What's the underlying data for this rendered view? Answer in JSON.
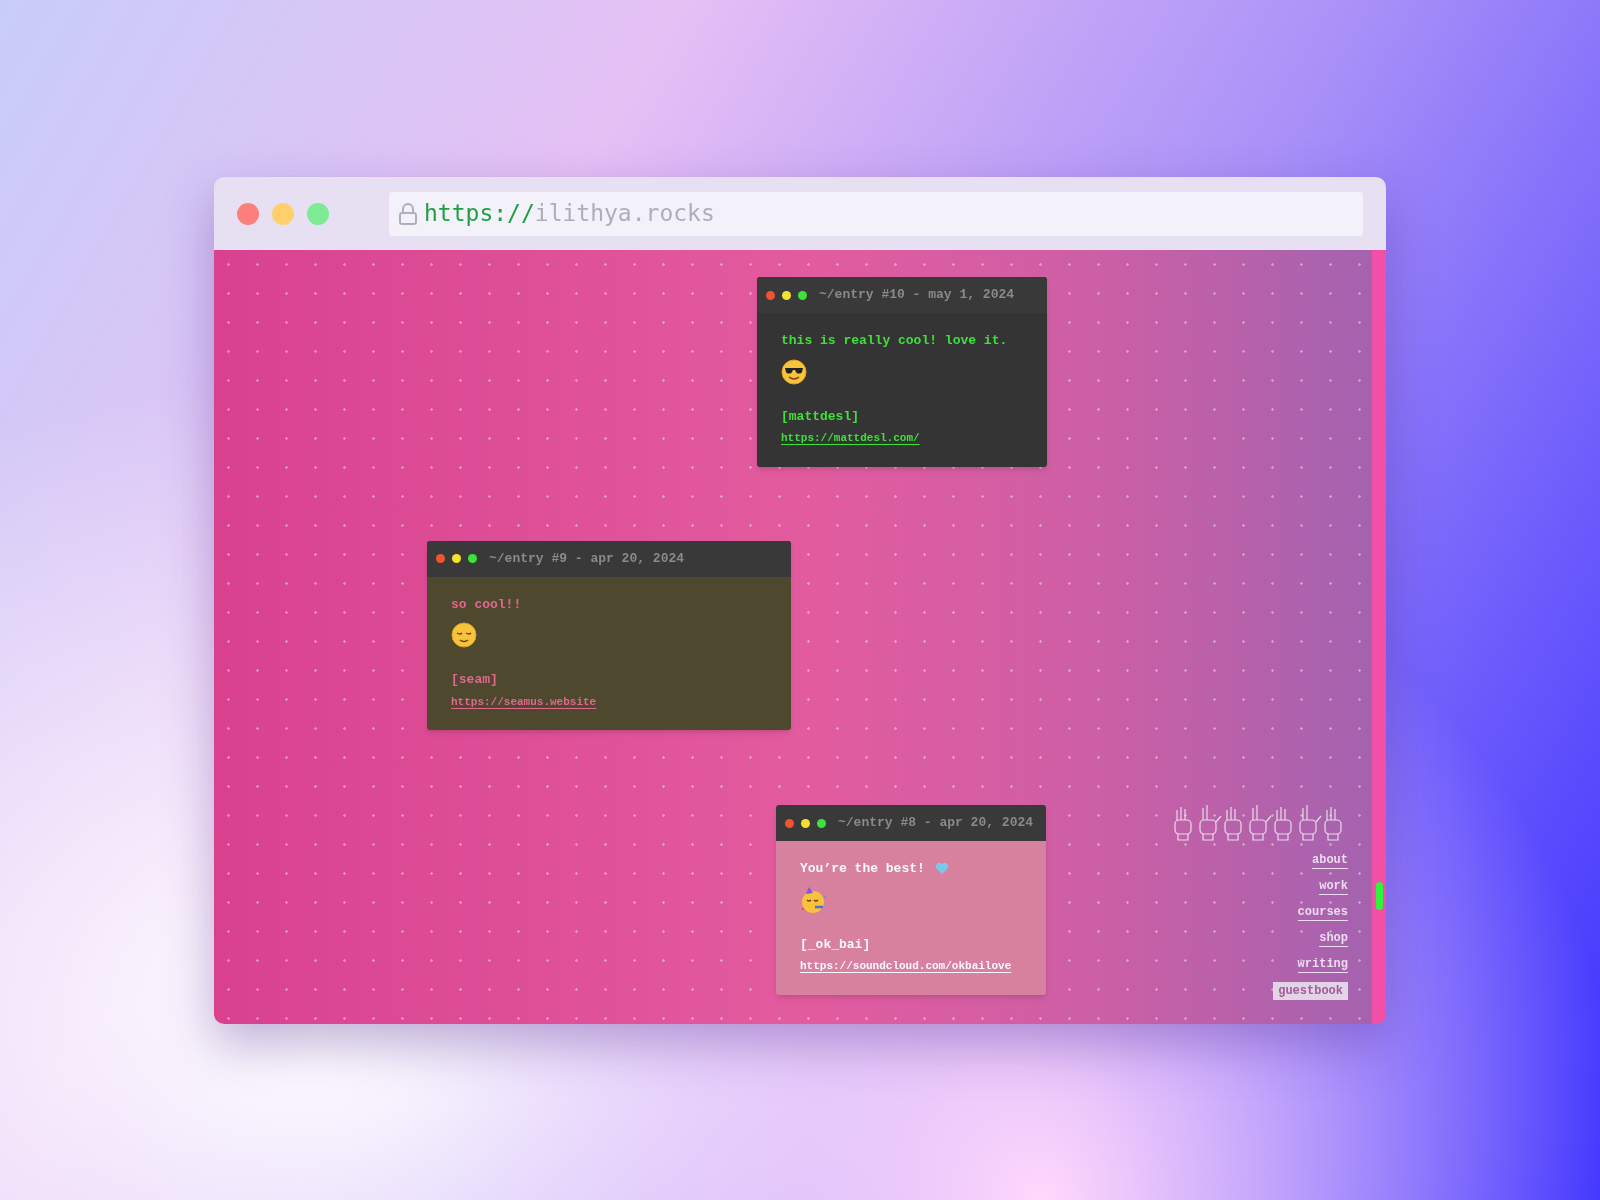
{
  "browser": {
    "url_scheme": "https://",
    "url_host": "ilithya.rocks"
  },
  "entries": [
    {
      "kind": "dark",
      "title": "~/entry #10 - may 1, 2024",
      "message": "this is really cool! love it.",
      "emoji": {
        "kind": "sunglasses"
      },
      "author": "[mattdesl]",
      "link": "https://mattdesl.com/"
    },
    {
      "kind": "olive",
      "title": "~/entry #9 - apr 20, 2024",
      "message": "so cool!!",
      "emoji": {
        "kind": "relieved"
      },
      "author": "[seam]",
      "link": "https://seamus.website"
    },
    {
      "kind": "pink",
      "title": "~/entry #8 - apr 20, 2024",
      "message": "You’re the best!",
      "message_icons": [
        {
          "kind": "heart"
        }
      ],
      "emoji": {
        "kind": "party"
      },
      "author": "[_ok_bai]",
      "link": "https://soundcloud.com/okbailove"
    }
  ],
  "nav": [
    {
      "label": "about",
      "selected": false
    },
    {
      "label": "work",
      "selected": false
    },
    {
      "label": "courses",
      "selected": false
    },
    {
      "label": "shop",
      "selected": false
    },
    {
      "label": "writing",
      "selected": false
    },
    {
      "label": "guestbook",
      "selected": true
    }
  ]
}
